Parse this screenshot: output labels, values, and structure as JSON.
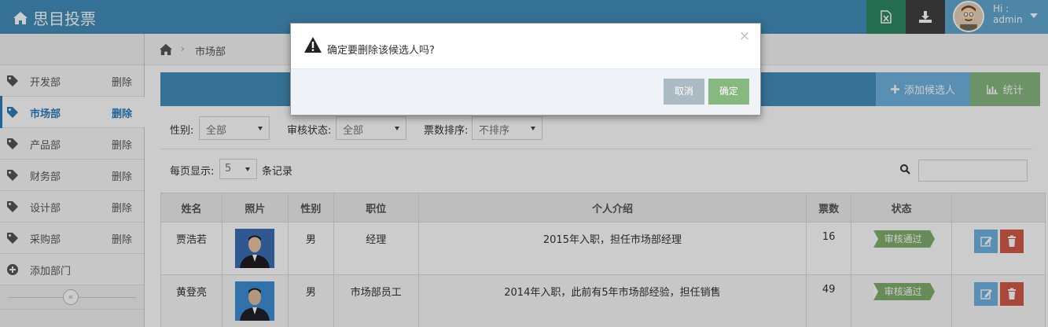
{
  "app": {
    "title": "思目投票"
  },
  "user": {
    "greeting": "Hi :",
    "name": "admin"
  },
  "sidebar": {
    "items": [
      {
        "label": "开发部",
        "delete_label": "删除"
      },
      {
        "label": "市场部",
        "delete_label": "删除",
        "active": true
      },
      {
        "label": "产品部",
        "delete_label": "删除"
      },
      {
        "label": "财务部",
        "delete_label": "删除"
      },
      {
        "label": "设计部",
        "delete_label": "删除"
      },
      {
        "label": "采购部",
        "delete_label": "删除"
      }
    ],
    "add_label": "添加部门",
    "collapse_glyph": "«"
  },
  "breadcrumb": {
    "separator": "›",
    "current": "市场部"
  },
  "toolbar": {
    "add_candidate_label": "添加候选人",
    "stats_label": "统计"
  },
  "filters": {
    "gender_label": "性别:",
    "gender_value": "全部",
    "review_label": "审核状态:",
    "review_value": "全部",
    "sort_label": "票数排序:",
    "sort_value": "不排序",
    "page_size_label": "每页显示:",
    "page_size_value": "5",
    "records_label": "条记录"
  },
  "table": {
    "headers": [
      "姓名",
      "照片",
      "性别",
      "职位",
      "个人介绍",
      "票数",
      "状态",
      ""
    ],
    "rows": [
      {
        "name": "贾浩若",
        "gender": "男",
        "position": "经理",
        "intro": "2015年入职，担任市场部经理",
        "votes": "16",
        "status": "审核通过"
      },
      {
        "name": "黄登亮",
        "gender": "男",
        "position": "市场部员工",
        "intro": "2014年入职，此前有5年市场部经验，担任销售",
        "votes": "49",
        "status": "审核通过"
      }
    ]
  },
  "modal": {
    "message": "确定要删除该候选人吗?",
    "close_glyph": "×",
    "cancel_label": "取消",
    "ok_label": "确定"
  },
  "colors": {
    "navbar": "#438eb9",
    "excel_button": "#2e8965",
    "download_button": "#404040",
    "add_button": "#6fb3e0",
    "stats_button": "#87b87f",
    "status_approved": "#82af6f",
    "delete_button": "#d15b47"
  },
  "icons": [
    "home-icon",
    "excel-icon",
    "download-icon",
    "tag-icon",
    "plus-circle-icon",
    "plus-icon",
    "bar-chart-icon",
    "search-icon",
    "edit-icon",
    "trash-icon",
    "warning-icon",
    "close-icon"
  ]
}
